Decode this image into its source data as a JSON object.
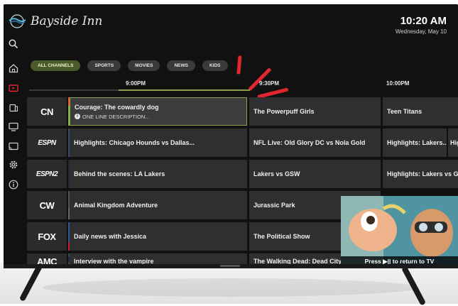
{
  "app": {
    "name": "Bayside Inn"
  },
  "clock": {
    "time": "10:20 AM",
    "date": "Wednesday, May 10"
  },
  "sidebar": {
    "items": [
      {
        "icon": "search-icon"
      },
      {
        "icon": "home-icon"
      },
      {
        "icon": "live-tv-icon"
      },
      {
        "icon": "devices-icon"
      },
      {
        "icon": "tv-icon"
      },
      {
        "icon": "cast-icon"
      },
      {
        "icon": "gear-icon"
      },
      {
        "icon": "info-icon"
      }
    ]
  },
  "filters": {
    "items": [
      "ALL CHANNELS",
      "SPORTS",
      "MOVIES",
      "NEWS",
      "KIDS"
    ],
    "active": "ALL CHANNELS"
  },
  "timeline": {
    "slots": [
      "9:00PM",
      "9:30PM",
      "10:00PM"
    ]
  },
  "guide": {
    "rows": [
      {
        "channel": "CN",
        "programs": [
          "Courage: The cowardly dog",
          "The Powerpuff Girls",
          "Teen Titans"
        ],
        "description": "ONE LINE DESCRIPTION..."
      },
      {
        "channel": "ESPN",
        "programs": [
          "Highlights: Chicago Hounds vs Dallas...",
          "NFL Live: Old Glory DC vs Nola Gold",
          "Highlights: Lakers...",
          "Hig"
        ]
      },
      {
        "channel": "ESPN2",
        "programs": [
          "Behind the scenes: LA Lakers",
          "Lakers vs GSW",
          "Highlights: Lakers vs GSW"
        ]
      },
      {
        "channel": "CW",
        "programs": [
          "Animal Kingdom Adventure",
          "Jurassic Park"
        ]
      },
      {
        "channel": "FOX",
        "programs": [
          "Daily news with Jessica",
          "The Political Show"
        ]
      },
      {
        "channel": "AMC",
        "programs": [
          "Interview with the vampire",
          "The Walking Dead: Dead City"
        ]
      }
    ]
  },
  "pip": {
    "caption": "Press ▶|| to return to TV"
  },
  "colors": {
    "accent": "#8aa04a",
    "marker": "#e0262f",
    "background": "#111111"
  }
}
